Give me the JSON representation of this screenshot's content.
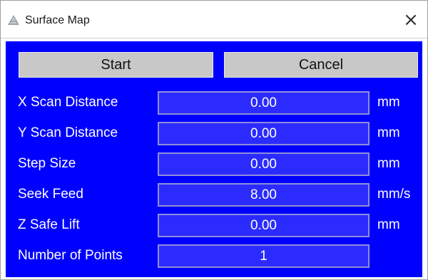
{
  "window": {
    "title": "Surface Map",
    "close_glyph": "×",
    "app_icon": "surface-map-icon",
    "background_color": "#0000ff"
  },
  "buttons": {
    "start_label": "Start",
    "cancel_label": "Cancel"
  },
  "fields": [
    {
      "label": "X Scan Distance",
      "value": "0.00",
      "unit": "mm"
    },
    {
      "label": "Y Scan Distance",
      "value": "0.00",
      "unit": "mm"
    },
    {
      "label": "Step Size",
      "value": "0.00",
      "unit": "mm"
    },
    {
      "label": "Seek Feed",
      "value": "8.00",
      "unit": "mm/s"
    },
    {
      "label": "Z Safe Lift",
      "value": "0.00",
      "unit": "mm"
    },
    {
      "label": "Number of Points",
      "value": "1",
      "unit": ""
    }
  ]
}
